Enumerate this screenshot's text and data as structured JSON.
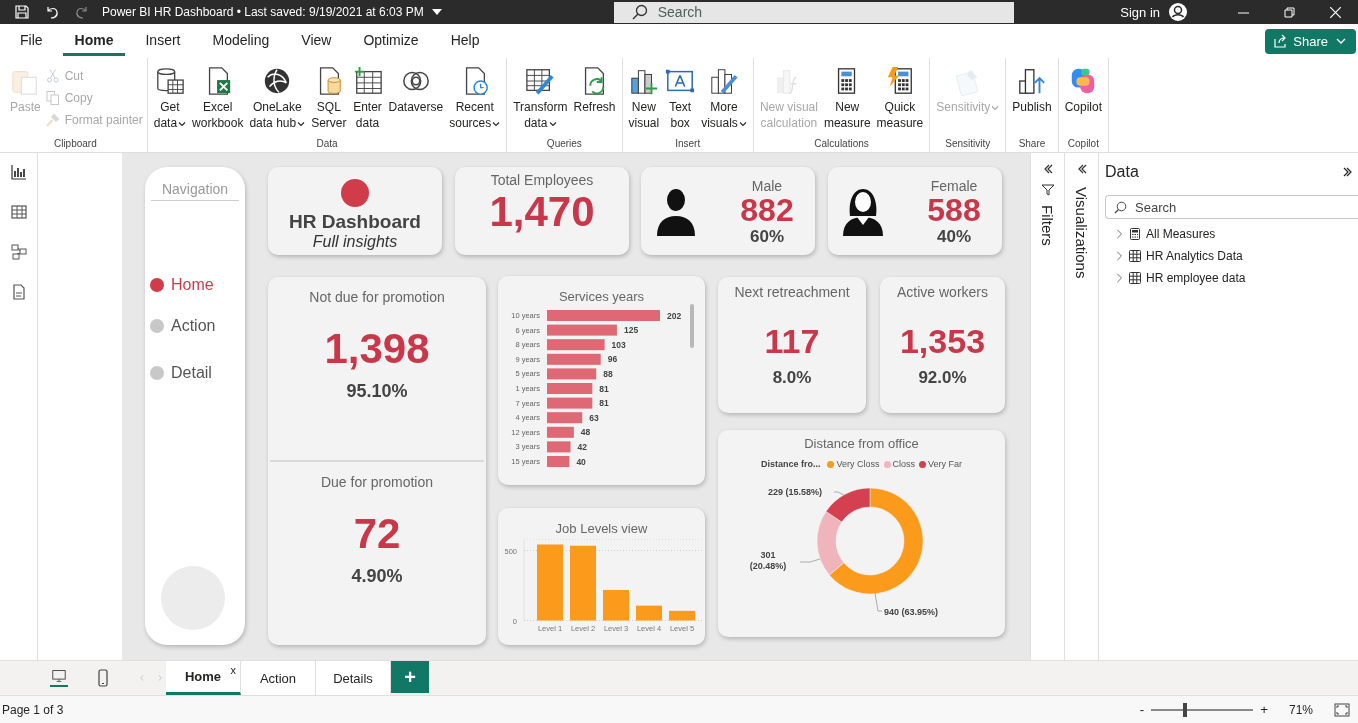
{
  "window": {
    "title": "Power BI HR Dashboard • Last saved: 9/19/2021 at 6:03 PM"
  },
  "title_bar": {
    "search": {
      "placeholder": "Search"
    },
    "sign_in": "Sign in"
  },
  "menu_tabs": [
    {
      "label": "File",
      "selected": false
    },
    {
      "label": "Home",
      "selected": true
    },
    {
      "label": "Insert",
      "selected": false
    },
    {
      "label": "Modeling",
      "selected": false
    },
    {
      "label": "View",
      "selected": false
    },
    {
      "label": "Optimize",
      "selected": false
    },
    {
      "label": "Help",
      "selected": false
    }
  ],
  "share_button": "Share",
  "ribbon": [
    {
      "label": "Clipboard",
      "buttons": [
        {
          "kind": "large",
          "lines": [
            "Paste"
          ],
          "disabled": true,
          "dropdown": false
        },
        {
          "kind": "small",
          "lines": [
            "Cut"
          ],
          "disabled": true,
          "dropdown": false
        },
        {
          "kind": "small",
          "lines": [
            "Copy"
          ],
          "disabled": true,
          "dropdown": false
        },
        {
          "kind": "small",
          "lines": [
            "Format painter"
          ],
          "disabled": true,
          "dropdown": false
        }
      ]
    },
    {
      "label": "Data",
      "buttons": [
        {
          "kind": "large",
          "lines": [
            "Get",
            "data"
          ],
          "disabled": false,
          "dropdown": true
        },
        {
          "kind": "large",
          "lines": [
            "Excel",
            "workbook"
          ],
          "disabled": false,
          "dropdown": false
        },
        {
          "kind": "large",
          "lines": [
            "OneLake",
            "data hub"
          ],
          "disabled": false,
          "dropdown": true
        },
        {
          "kind": "large",
          "lines": [
            "SQL",
            "Server"
          ],
          "disabled": false,
          "dropdown": false
        },
        {
          "kind": "large",
          "lines": [
            "Enter",
            "data"
          ],
          "disabled": false,
          "dropdown": false
        },
        {
          "kind": "large",
          "lines": [
            "Dataverse"
          ],
          "disabled": false,
          "dropdown": false
        },
        {
          "kind": "large",
          "lines": [
            "Recent",
            "sources"
          ],
          "disabled": false,
          "dropdown": true
        }
      ]
    },
    {
      "label": "Queries",
      "buttons": [
        {
          "kind": "large",
          "lines": [
            "Transform",
            "data"
          ],
          "disabled": false,
          "dropdown": true
        },
        {
          "kind": "large",
          "lines": [
            "Refresh"
          ],
          "disabled": false,
          "dropdown": false
        }
      ]
    },
    {
      "label": "Insert",
      "buttons": [
        {
          "kind": "large",
          "lines": [
            "New",
            "visual"
          ],
          "disabled": false,
          "dropdown": false
        },
        {
          "kind": "large",
          "lines": [
            "Text",
            "box"
          ],
          "disabled": false,
          "dropdown": false
        },
        {
          "kind": "large",
          "lines": [
            "More",
            "visuals"
          ],
          "disabled": false,
          "dropdown": true
        }
      ]
    },
    {
      "label": "Calculations",
      "buttons": [
        {
          "kind": "large",
          "lines": [
            "New visual",
            "calculation"
          ],
          "disabled": true,
          "dropdown": false
        },
        {
          "kind": "large",
          "lines": [
            "New",
            "measure"
          ],
          "disabled": false,
          "dropdown": false
        },
        {
          "kind": "large",
          "lines": [
            "Quick",
            "measure"
          ],
          "disabled": false,
          "dropdown": false
        }
      ]
    },
    {
      "label": "Sensitivity",
      "buttons": [
        {
          "kind": "large",
          "lines": [
            "Sensitivity"
          ],
          "disabled": true,
          "dropdown": true
        }
      ]
    },
    {
      "label": "Share",
      "buttons": [
        {
          "kind": "large",
          "lines": [
            "Publish"
          ],
          "disabled": false,
          "dropdown": false
        }
      ]
    },
    {
      "label": "Copilot",
      "buttons": [
        {
          "kind": "large",
          "lines": [
            "Copilot"
          ],
          "disabled": false,
          "dropdown": false
        }
      ]
    }
  ],
  "report": {
    "navigation": {
      "title": "Navigation",
      "items": [
        {
          "label": "Home",
          "selected": true
        },
        {
          "label": "Action",
          "selected": false
        },
        {
          "label": "Detail",
          "selected": false
        }
      ]
    },
    "header_card": {
      "title": "HR Dashboard",
      "subtitle": "Full insights"
    },
    "kpis": [
      {
        "kind": "plain",
        "label": "Total Employees",
        "value": "1,470"
      },
      {
        "kind": "male",
        "label": "Male",
        "value": "882",
        "share": "60%"
      },
      {
        "kind": "female",
        "label": "Female",
        "value": "588",
        "share": "40%"
      }
    ],
    "promotion": [
      {
        "label": "Not due for promotion",
        "value": "1,398",
        "share": "95.10%"
      },
      {
        "label": "Due for promotion",
        "value": "72",
        "share": "4.90%"
      }
    ],
    "workforce": [
      {
        "label": "Next retreachment",
        "value": "117",
        "share": "8.0%"
      },
      {
        "label": "Active workers",
        "value": "1,353",
        "share": "92.0%"
      }
    ],
    "services_chart": {
      "chart_data": {
        "type": "bar",
        "orientation": "horizontal",
        "title": "Services years",
        "categories": [
          "10 years",
          "6 years",
          "8 years",
          "9 years",
          "5 years",
          "1 years",
          "7 years",
          "4 years",
          "12 years",
          "3 years",
          "15 years"
        ],
        "series": [
          {
            "color": "#de6873",
            "values": [
              202,
              125,
              103,
              96,
              88,
              81,
              81,
              63,
              48,
              42,
              40
            ]
          }
        ],
        "data_labels": true
      }
    },
    "job_levels_chart": {
      "chart_data": {
        "type": "bar",
        "title": "Job Levels view",
        "categories": [
          "Level 1",
          "Level 2",
          "Level 3",
          "Level 4",
          "Level 5"
        ],
        "series": [
          {
            "color": "#fb9a1b",
            "values": [
              543,
              534,
              218,
              106,
              69
            ]
          }
        ],
        "ylim": [
          0,
          580
        ],
        "yticks": [
          0,
          500
        ]
      }
    },
    "distance_chart": {
      "legend_title": "Distance fro...",
      "chart_data": {
        "type": "donut",
        "title": "Distance from office",
        "categories": [
          "Very Closs",
          "Closs",
          "Very Far"
        ],
        "values": [
          940,
          301,
          229
        ],
        "colors": [
          "#fb9a1b",
          "#f0b4bc",
          "#d4404f"
        ],
        "value_labels": [
          "940 (63.95%)",
          "301 (20.48%)",
          "229 (15.58%)"
        ]
      }
    }
  },
  "panes": {
    "filters": {
      "label": "Filters"
    },
    "visualizations": {
      "label": "Visualizations"
    },
    "data": {
      "title": "Data",
      "search": {
        "placeholder": "Search"
      },
      "items": [
        {
          "kind": "measures",
          "label": "All Measures",
          "expanded": false
        },
        {
          "kind": "table",
          "label": "HR Analytics Data",
          "expanded": false
        },
        {
          "kind": "table",
          "label": "HR employee data",
          "expanded": false
        }
      ]
    }
  },
  "page_tabs": [
    {
      "label": "Home",
      "selected": true,
      "close": "x"
    },
    {
      "label": "Action",
      "selected": false
    },
    {
      "label": "Details",
      "selected": false
    }
  ],
  "add_page": "+",
  "status_bar": {
    "page": "Page 1 of 3",
    "zoom": {
      "minus": "-",
      "plus": "+",
      "level": 0.33,
      "reading": "71%"
    }
  }
}
